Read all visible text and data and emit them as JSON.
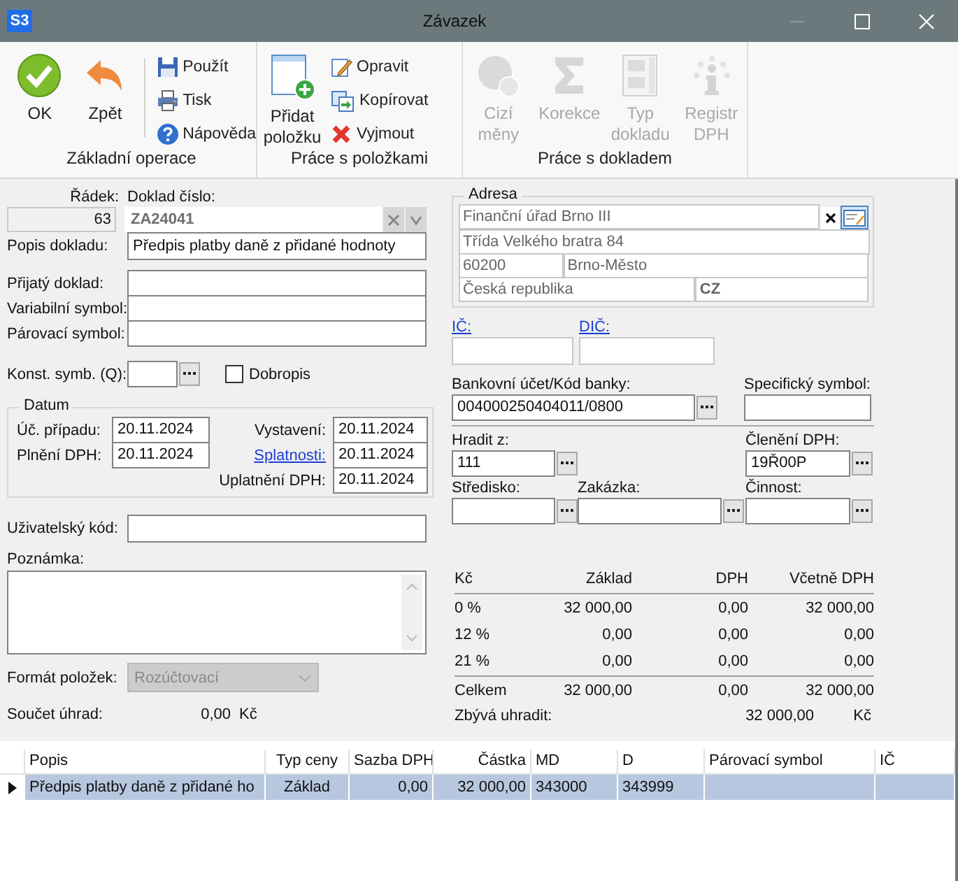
{
  "window": {
    "logo": "S3",
    "title": "Závazek"
  },
  "ribbon": {
    "groups": [
      {
        "label": "Základní operace",
        "separator": true,
        "buttons": [
          {
            "label": "OK",
            "kind": "large",
            "disabled": false
          },
          {
            "label": "Zpět",
            "kind": "large",
            "disabled": false
          },
          {
            "label": "Použít",
            "kind": "small",
            "disabled": false
          },
          {
            "label": "Tisk",
            "kind": "small",
            "disabled": false
          },
          {
            "label": "Nápověda",
            "kind": "small",
            "disabled": false
          }
        ]
      },
      {
        "label": "Práce s položkami",
        "separator": false,
        "buttons": [
          {
            "label": "Přidat položku",
            "kind": "large",
            "disabled": false
          },
          {
            "label": "Opravit",
            "kind": "small",
            "disabled": false
          },
          {
            "label": "Kopírovat",
            "kind": "small",
            "disabled": false
          },
          {
            "label": "Vyjmout",
            "kind": "small",
            "disabled": false
          }
        ]
      },
      {
        "label": "Práce s dokladem",
        "separator": false,
        "buttons": [
          {
            "label": "Cizí měny",
            "kind": "large",
            "disabled": true
          },
          {
            "label": "Korekce",
            "kind": "large",
            "disabled": true
          },
          {
            "label": "Typ dokladu",
            "kind": "large",
            "disabled": true
          },
          {
            "label": "Registr DPH",
            "kind": "large",
            "disabled": true
          }
        ]
      }
    ]
  },
  "document": {
    "row": {
      "label": "Řádek:",
      "value": "63"
    },
    "number": {
      "label": "Doklad číslo:",
      "value": "ZA24041",
      "disabled": true
    },
    "description": {
      "label": "Popis dokladu:",
      "value": "Předpis platby daně z přidané hodnoty"
    },
    "symbols": [
      {
        "label": "Přijatý doklad:"
      },
      {
        "label": "Variabilní symbol:"
      },
      {
        "label": "Párovací symbol:"
      }
    ],
    "constant_symbol": {
      "label": "Konst. symb. (Q):"
    },
    "credit_note": {
      "label": "Dobropis",
      "checked": false
    },
    "dates": {
      "title": "Datum",
      "left": [
        {
          "label": "Úč. případu:",
          "value": "20.11.2024",
          "link": false
        },
        {
          "label": "Plnění DPH:",
          "value": "20.11.2024",
          "link": false
        }
      ],
      "right": [
        {
          "label": "Vystavení:",
          "value": "20.11.2024",
          "link": false
        },
        {
          "label": "Splatnosti:",
          "value": "20.11.2024",
          "link": true
        },
        {
          "label": "Uplatnění DPH:",
          "value": "20.11.2024",
          "link": false
        }
      ]
    },
    "user_code": {
      "label": "Uživatelský kód:"
    },
    "note": {
      "label": "Poznámka:"
    },
    "item_format": {
      "label": "Formát položek:",
      "value": "Rozúčtovací",
      "disabled": true
    },
    "payments_total": {
      "label": "Součet úhrad:",
      "value": "0,00",
      "currency": "Kč"
    }
  },
  "address": {
    "title": "Adresa",
    "name": "Finanční úřad Brno III",
    "street": "Třída Velkého bratra  84",
    "zip": "60200",
    "city": "Brno-Město",
    "country": "Česká republika",
    "country_code": "CZ"
  },
  "partner": {
    "ic": {
      "label": "IČ:",
      "link": true
    },
    "dic": {
      "label": "DIČ:",
      "link": true
    }
  },
  "payment": {
    "bank_account": {
      "label": "Bankovní účet/Kód banky:",
      "value": "004000250404011/0800"
    },
    "specific_symbol": {
      "label": "Specifický symbol:"
    }
  },
  "accounting": {
    "pay_from": {
      "label": "Hradit z:",
      "value": "111"
    },
    "vat_split": {
      "label": "Členění DPH:",
      "value": "19Ř00P"
    },
    "center": {
      "label": "Středisko:"
    },
    "order": {
      "label": "Zakázka:"
    },
    "activity": {
      "label": "Činnost:"
    }
  },
  "vat_summary": {
    "columns": [
      "Kč",
      "Základ",
      "DPH",
      "Včetně DPH"
    ],
    "rows": [
      {
        "cells": [
          "0 %",
          "32 000,00",
          "0,00",
          "32 000,00"
        ]
      },
      {
        "cells": [
          "12 %",
          "0,00",
          "0,00",
          "0,00"
        ]
      },
      {
        "cells": [
          "21 %",
          "0,00",
          "0,00",
          "0,00"
        ]
      }
    ],
    "total": {
      "cells": [
        "Celkem",
        "32 000,00",
        "0,00",
        "32 000,00"
      ]
    },
    "remaining": {
      "label": "Zbývá uhradit:",
      "value": "32 000,00",
      "currency": "Kč"
    }
  },
  "items_table": {
    "columns": [
      "Popis",
      "Typ ceny",
      "Sazba DPH",
      "Částka",
      "MD",
      "D",
      "Párovací symbol",
      "IČ"
    ],
    "rows": [
      {
        "selected": true,
        "cells": [
          "Předpis platby daně z přidané ho",
          "Základ",
          "0,00",
          "32 000,00",
          "343000",
          "343999"
        ]
      }
    ]
  }
}
